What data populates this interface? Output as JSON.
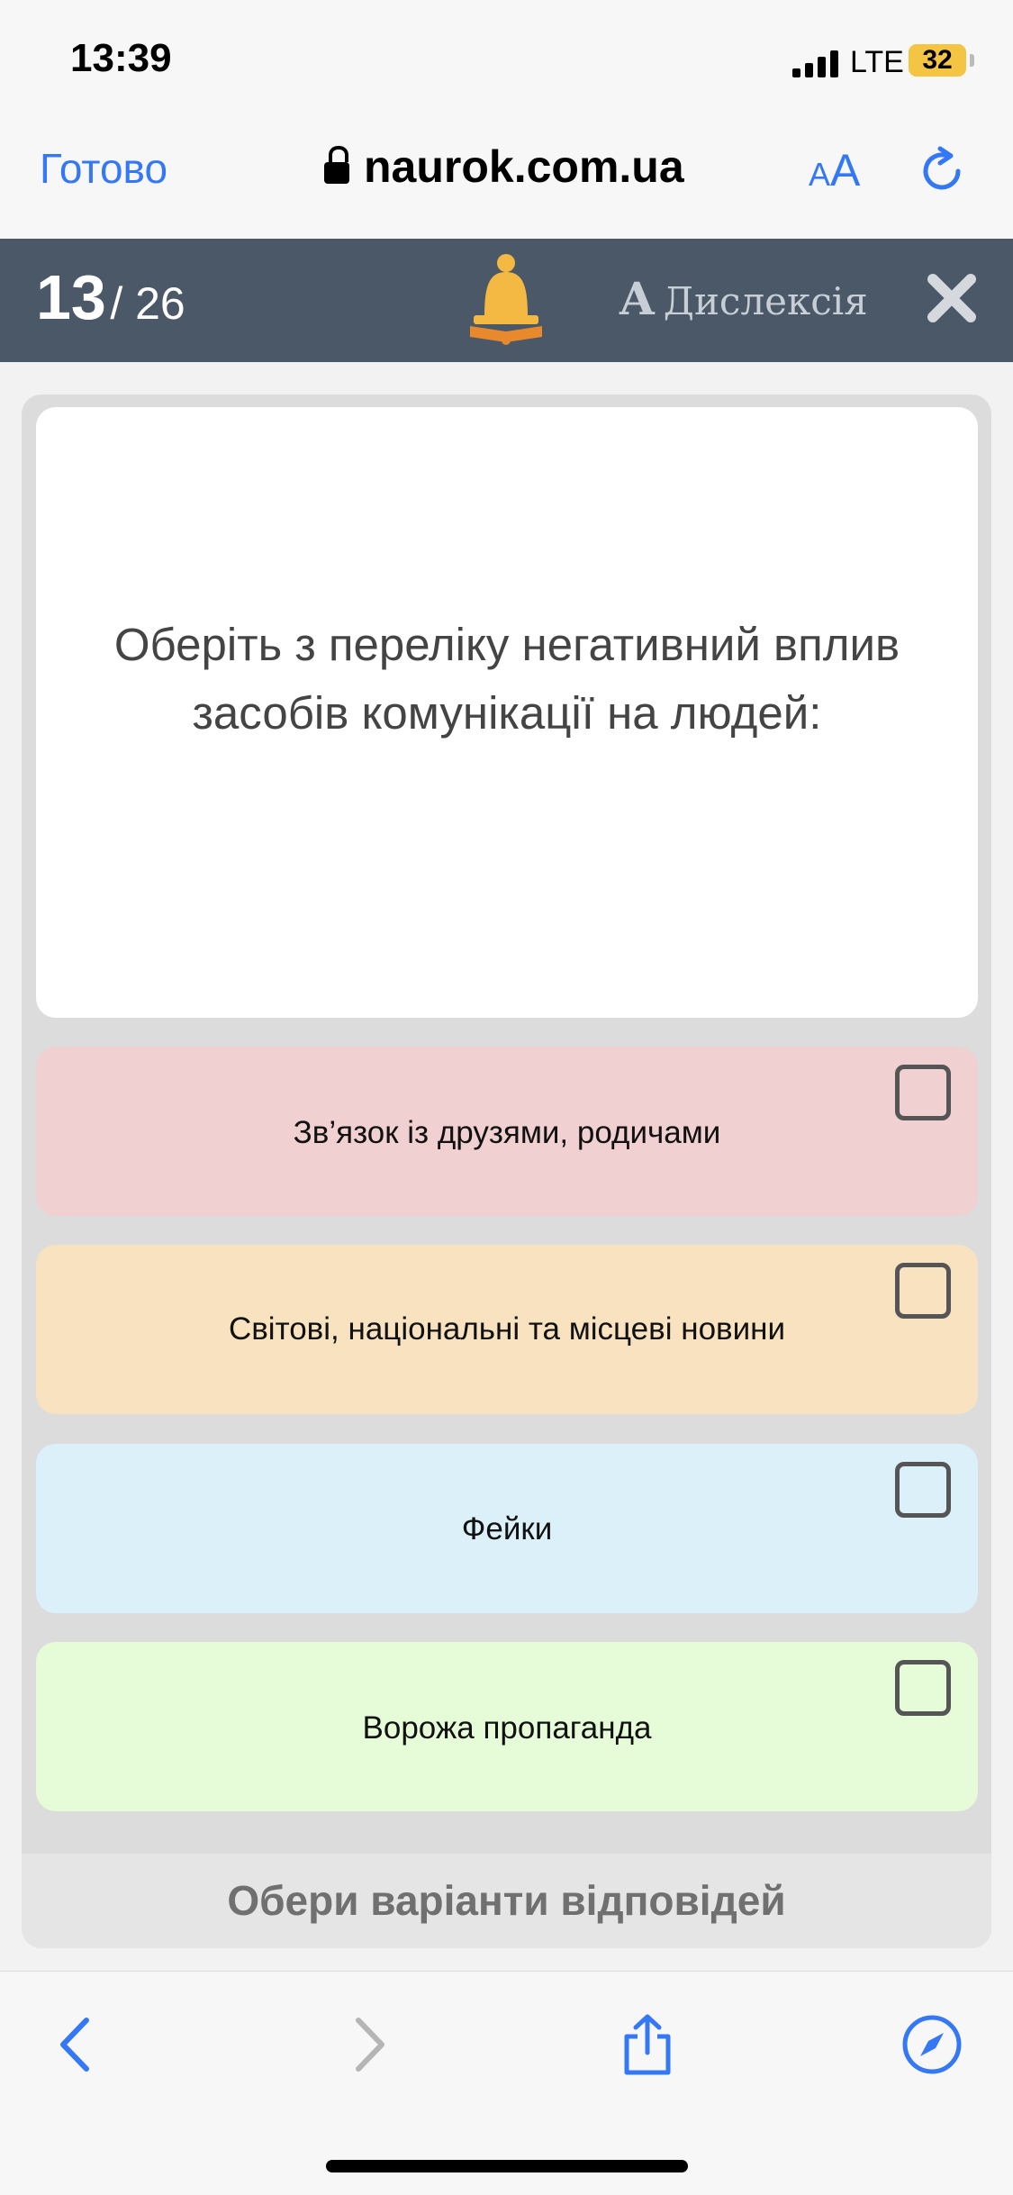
{
  "status_bar": {
    "time": "13:39",
    "network": "LTE",
    "battery": "32"
  },
  "browser": {
    "done_label": "Готово",
    "url": "naurok.com.ua",
    "text_size_small": "A",
    "text_size_big": "A"
  },
  "quiz_header": {
    "current": "13",
    "total": "/ 26",
    "dyslexia_a": "A",
    "dyslexia_label": "Дислексія"
  },
  "question": {
    "line1": "Оберіть з переліку негативний вплив",
    "line2": "засобів комунікації на людей:"
  },
  "options": [
    {
      "label": "Зв’язок із друзями, родичами",
      "color": "#f0d0d0",
      "checked": false
    },
    {
      "label": "Світові, національні та місцеві новини",
      "color": "#f8e2c0",
      "checked": false
    },
    {
      "label": "Фейки",
      "color": "#dcf0fa",
      "checked": false
    },
    {
      "label": "Ворожа пропаганда",
      "color": "#e6fcd8",
      "checked": false
    }
  ],
  "submit_label": "Обери варіанти відповідей",
  "colors": {
    "accent": "#3478f6",
    "header_bg": "#4a5868",
    "bell": "#f4b942"
  },
  "icons": [
    "lock-icon",
    "reload-icon",
    "bell-icon",
    "close-icon",
    "back-icon",
    "forward-icon",
    "share-icon",
    "compass-icon"
  ]
}
